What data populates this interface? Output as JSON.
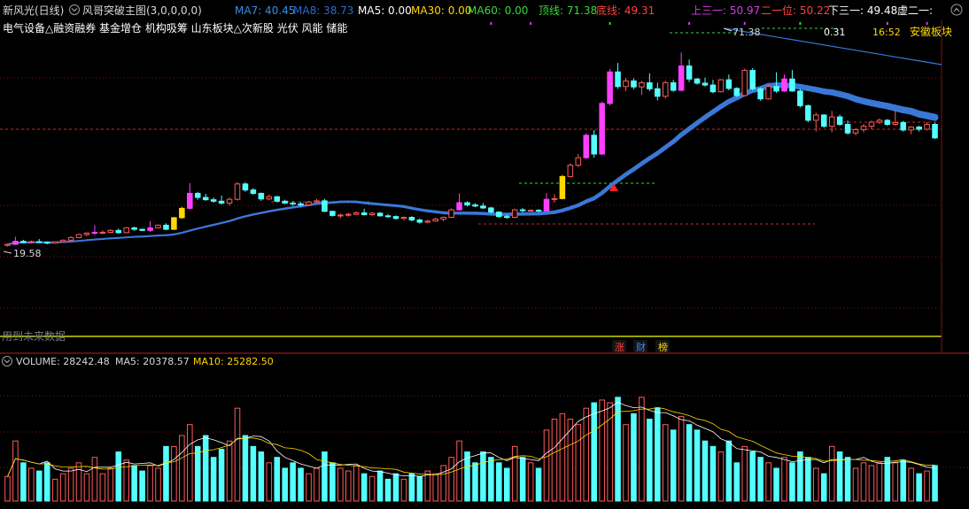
{
  "header": {
    "stock_name": "新风光(日线)",
    "indicator": "风哥突破主图(3,0,0,0,0)",
    "ma7": "MA7: 40.45",
    "ma8": "MA8: 38.73",
    "ma5": "MA5: 0.00",
    "ma30": "MA30: 0.00",
    "ma60": "MA60: 0.00",
    "top_line": "顶线: 71.38",
    "bottom_line": "底线: 49.31",
    "upper3": "上三一: 50.97",
    "second": "二一位: 50.22",
    "lower3": "下三一: 49.48",
    "virtual": "虚二一:"
  },
  "concepts": "电气设备△融资融券 基金增仓 机构吸筹 山东板块△次新股 光伏 风能 储能",
  "annotations": {
    "price_low": "19.58",
    "price_high": "71.38",
    "ratio": "0.31",
    "time": "16:52",
    "sector": "安徽板块",
    "future_data": "用到未来数据"
  },
  "bottom_buttons": [
    "涨",
    "财",
    "榜"
  ],
  "volume_header": {
    "label": "VOLUME: 28242.48",
    "ma5": "MA5: 20378.57",
    "ma10": "MA10: 25282.50"
  },
  "colors": {
    "up": "#ff5a5a",
    "down": "#54ffff",
    "signal_up": "#ff40ff",
    "signal_gold": "#ffd800",
    "ma_line": "#3a78d8",
    "volume_ma5": "#ffffff",
    "volume_ma10": "#ffd800",
    "grid": "#7a1414"
  },
  "chart_data": {
    "type": "candlestick",
    "ylim": [
      15,
      75
    ],
    "volume_ylim": [
      0,
      48000
    ],
    "candles": [
      {
        "o": 19.9,
        "h": 20.4,
        "l": 19.6,
        "c": 20.2,
        "v": 9000
      },
      {
        "o": 20.2,
        "h": 22.2,
        "l": 20.0,
        "c": 21.0,
        "v": 22000,
        "s": "p"
      },
      {
        "o": 21.0,
        "h": 21.4,
        "l": 20.5,
        "c": 20.7,
        "v": 14000
      },
      {
        "o": 20.7,
        "h": 21.2,
        "l": 20.4,
        "c": 20.9,
        "v": 12000
      },
      {
        "o": 20.9,
        "h": 21.6,
        "l": 20.6,
        "c": 20.8,
        "v": 11000
      },
      {
        "o": 20.8,
        "h": 21.0,
        "l": 20.2,
        "c": 20.5,
        "v": 14000
      },
      {
        "o": 20.5,
        "h": 21.0,
        "l": 20.3,
        "c": 20.9,
        "v": 8000
      },
      {
        "o": 20.9,
        "h": 21.5,
        "l": 20.7,
        "c": 21.3,
        "v": 10000
      },
      {
        "o": 21.3,
        "h": 22.3,
        "l": 21.1,
        "c": 22.0,
        "v": 12000
      },
      {
        "o": 22.0,
        "h": 23.0,
        "l": 21.8,
        "c": 22.8,
        "v": 14000
      },
      {
        "o": 22.8,
        "h": 23.4,
        "l": 22.4,
        "c": 23.2,
        "v": 10000
      },
      {
        "o": 23.2,
        "h": 25.3,
        "l": 22.8,
        "c": 23.4,
        "v": 16000,
        "s": "p"
      },
      {
        "o": 23.4,
        "h": 23.9,
        "l": 22.9,
        "c": 23.4,
        "v": 10000
      },
      {
        "o": 23.4,
        "h": 24.2,
        "l": 23.2,
        "c": 23.9,
        "v": 12000
      },
      {
        "o": 23.9,
        "h": 24.4,
        "l": 23.0,
        "c": 23.3,
        "v": 18000
      },
      {
        "o": 23.3,
        "h": 24.8,
        "l": 23.1,
        "c": 24.6,
        "v": 15000
      },
      {
        "o": 24.6,
        "h": 24.9,
        "l": 23.8,
        "c": 24.2,
        "v": 13000
      },
      {
        "o": 24.2,
        "h": 24.4,
        "l": 23.7,
        "c": 23.9,
        "v": 11000
      },
      {
        "o": 23.9,
        "h": 26.4,
        "l": 23.5,
        "c": 24.6,
        "v": 13000,
        "s": "p"
      },
      {
        "o": 24.6,
        "h": 25.5,
        "l": 24.4,
        "c": 25.3,
        "v": 12000
      },
      {
        "o": 25.3,
        "h": 25.8,
        "l": 24.0,
        "c": 24.2,
        "v": 20000
      },
      {
        "o": 24.2,
        "h": 27.5,
        "l": 24.0,
        "c": 27.3,
        "v": 20000,
        "s": "g"
      },
      {
        "o": 27.3,
        "h": 30.2,
        "l": 27.0,
        "c": 29.8,
        "v": 24000,
        "s": "g"
      },
      {
        "o": 29.8,
        "h": 36.5,
        "l": 29.5,
        "c": 33.8,
        "v": 28000,
        "s": "p"
      },
      {
        "o": 33.8,
        "h": 34.2,
        "l": 32.1,
        "c": 32.7,
        "v": 20000
      },
      {
        "o": 32.7,
        "h": 33.7,
        "l": 31.8,
        "c": 32.1,
        "v": 24000
      },
      {
        "o": 32.1,
        "h": 32.7,
        "l": 31.3,
        "c": 31.7,
        "v": 16000
      },
      {
        "o": 31.7,
        "h": 33.2,
        "l": 30.8,
        "c": 31.2,
        "v": 19000
      },
      {
        "o": 31.2,
        "h": 32.7,
        "l": 30.5,
        "c": 32.2,
        "v": 22000
      },
      {
        "o": 32.2,
        "h": 36.8,
        "l": 31.9,
        "c": 36.3,
        "v": 34000
      },
      {
        "o": 36.3,
        "h": 36.8,
        "l": 34.2,
        "c": 34.7,
        "v": 24000
      },
      {
        "o": 34.7,
        "h": 35.2,
        "l": 33.4,
        "c": 33.8,
        "v": 20000
      },
      {
        "o": 33.8,
        "h": 34.0,
        "l": 31.8,
        "c": 32.3,
        "v": 18000
      },
      {
        "o": 32.3,
        "h": 33.5,
        "l": 31.9,
        "c": 32.9,
        "v": 14000
      },
      {
        "o": 32.9,
        "h": 33.1,
        "l": 31.4,
        "c": 31.7,
        "v": 16000
      },
      {
        "o": 31.7,
        "h": 32.1,
        "l": 30.9,
        "c": 31.2,
        "v": 12000
      },
      {
        "o": 31.2,
        "h": 31.7,
        "l": 30.5,
        "c": 31.0,
        "v": 14000
      },
      {
        "o": 31.0,
        "h": 31.5,
        "l": 30.3,
        "c": 30.7,
        "v": 12000
      },
      {
        "o": 30.7,
        "h": 31.8,
        "l": 30.5,
        "c": 31.5,
        "v": 10000
      },
      {
        "o": 31.5,
        "h": 32.3,
        "l": 31.1,
        "c": 31.8,
        "v": 12000
      },
      {
        "o": 31.8,
        "h": 32.3,
        "l": 28.8,
        "c": 29.0,
        "v": 18000
      },
      {
        "o": 29.0,
        "h": 29.1,
        "l": 27.6,
        "c": 27.9,
        "v": 14000
      },
      {
        "o": 27.9,
        "h": 28.4,
        "l": 27.2,
        "c": 28.0,
        "v": 12000
      },
      {
        "o": 28.0,
        "h": 28.6,
        "l": 27.6,
        "c": 28.2,
        "v": 11000
      },
      {
        "o": 28.2,
        "h": 29.0,
        "l": 28.0,
        "c": 28.6,
        "v": 13000
      },
      {
        "o": 28.6,
        "h": 29.7,
        "l": 27.9,
        "c": 28.1,
        "v": 10000
      },
      {
        "o": 28.1,
        "h": 28.8,
        "l": 27.8,
        "c": 28.5,
        "v": 9000
      },
      {
        "o": 28.5,
        "h": 28.8,
        "l": 27.6,
        "c": 27.8,
        "v": 11000
      },
      {
        "o": 27.8,
        "h": 28.2,
        "l": 27.3,
        "c": 27.6,
        "v": 8000
      },
      {
        "o": 27.6,
        "h": 27.9,
        "l": 26.8,
        "c": 27.1,
        "v": 10000
      },
      {
        "o": 27.1,
        "h": 27.6,
        "l": 26.6,
        "c": 27.4,
        "v": 8000
      },
      {
        "o": 27.4,
        "h": 27.7,
        "l": 26.3,
        "c": 26.7,
        "v": 10000
      },
      {
        "o": 26.7,
        "h": 27.1,
        "l": 25.7,
        "c": 26.1,
        "v": 9000
      },
      {
        "o": 26.1,
        "h": 26.7,
        "l": 25.8,
        "c": 26.4,
        "v": 11000
      },
      {
        "o": 26.4,
        "h": 27.3,
        "l": 26.2,
        "c": 26.9,
        "v": 10000
      },
      {
        "o": 26.9,
        "h": 27.6,
        "l": 26.3,
        "c": 27.4,
        "v": 13000
      },
      {
        "o": 27.4,
        "h": 29.8,
        "l": 27.2,
        "c": 29.4,
        "v": 16000
      },
      {
        "o": 29.4,
        "h": 33.8,
        "l": 29.2,
        "c": 31.3,
        "v": 22000,
        "s": "p"
      },
      {
        "o": 31.3,
        "h": 31.7,
        "l": 30.3,
        "c": 30.7,
        "v": 18000
      },
      {
        "o": 30.7,
        "h": 31.2,
        "l": 30.1,
        "c": 30.4,
        "v": 14000
      },
      {
        "o": 30.4,
        "h": 31.2,
        "l": 29.6,
        "c": 29.9,
        "v": 18000
      },
      {
        "o": 29.9,
        "h": 30.2,
        "l": 28.4,
        "c": 28.8,
        "v": 16000
      },
      {
        "o": 28.8,
        "h": 29.0,
        "l": 27.3,
        "c": 27.6,
        "v": 14000
      },
      {
        "o": 27.6,
        "h": 28.1,
        "l": 27.0,
        "c": 27.4,
        "v": 12000
      },
      {
        "o": 27.4,
        "h": 29.7,
        "l": 27.2,
        "c": 29.4,
        "v": 20000
      },
      {
        "o": 29.4,
        "h": 29.9,
        "l": 28.8,
        "c": 29.2,
        "v": 16000
      },
      {
        "o": 29.2,
        "h": 29.5,
        "l": 28.9,
        "c": 29.3,
        "v": 14000
      },
      {
        "o": 29.3,
        "h": 29.6,
        "l": 28.8,
        "c": 29.1,
        "v": 12000
      },
      {
        "o": 29.1,
        "h": 33.8,
        "l": 28.9,
        "c": 32.2,
        "v": 26000,
        "s": "p"
      },
      {
        "o": 32.2,
        "h": 33.6,
        "l": 31.3,
        "c": 32.4,
        "v": 30000
      },
      {
        "o": 32.4,
        "h": 38.7,
        "l": 32.2,
        "c": 38.3,
        "v": 32000,
        "s": "g"
      },
      {
        "o": 38.3,
        "h": 41.8,
        "l": 38.0,
        "c": 41.3,
        "v": 30000
      },
      {
        "o": 41.3,
        "h": 44.3,
        "l": 40.8,
        "c": 43.3,
        "v": 28000
      },
      {
        "o": 43.3,
        "h": 49.8,
        "l": 43.0,
        "c": 49.3,
        "v": 34000,
        "s": "p"
      },
      {
        "o": 49.3,
        "h": 50.7,
        "l": 43.3,
        "c": 44.3,
        "v": 36000
      },
      {
        "o": 44.3,
        "h": 58.3,
        "l": 44.0,
        "c": 57.8,
        "v": 37000,
        "s": "p"
      },
      {
        "o": 57.8,
        "h": 67.0,
        "l": 57.3,
        "c": 66.2,
        "v": 36000,
        "s": "p"
      },
      {
        "o": 66.2,
        "h": 68.6,
        "l": 61.7,
        "c": 62.3,
        "v": 38000
      },
      {
        "o": 62.3,
        "h": 64.6,
        "l": 61.1,
        "c": 63.8,
        "v": 28000
      },
      {
        "o": 63.8,
        "h": 64.5,
        "l": 61.6,
        "c": 62.2,
        "v": 32000
      },
      {
        "o": 62.2,
        "h": 63.8,
        "l": 60.1,
        "c": 63.3,
        "v": 38000
      },
      {
        "o": 63.3,
        "h": 65.8,
        "l": 61.1,
        "c": 61.7,
        "v": 30000
      },
      {
        "o": 61.7,
        "h": 63.3,
        "l": 58.6,
        "c": 59.7,
        "v": 34000
      },
      {
        "o": 59.7,
        "h": 63.8,
        "l": 59.1,
        "c": 63.3,
        "v": 28000
      },
      {
        "o": 63.3,
        "h": 64.1,
        "l": 60.9,
        "c": 61.3,
        "v": 26000
      },
      {
        "o": 61.3,
        "h": 71.4,
        "l": 61.0,
        "c": 67.8,
        "v": 31000,
        "s": "p"
      },
      {
        "o": 67.8,
        "h": 69.5,
        "l": 63.5,
        "c": 64.3,
        "v": 28000
      },
      {
        "o": 64.3,
        "h": 64.6,
        "l": 62.8,
        "c": 63.2,
        "v": 26000
      },
      {
        "o": 63.2,
        "h": 64.7,
        "l": 62.3,
        "c": 62.7,
        "v": 22000
      },
      {
        "o": 62.7,
        "h": 64.1,
        "l": 60.5,
        "c": 60.9,
        "v": 20000
      },
      {
        "o": 60.9,
        "h": 64.3,
        "l": 60.7,
        "c": 64.1,
        "v": 18000
      },
      {
        "o": 64.1,
        "h": 65.5,
        "l": 61.3,
        "c": 61.8,
        "v": 22000
      },
      {
        "o": 61.8,
        "h": 62.1,
        "l": 59.5,
        "c": 59.9,
        "v": 14000
      },
      {
        "o": 59.9,
        "h": 67.1,
        "l": 59.6,
        "c": 66.6,
        "v": 20000
      },
      {
        "o": 66.6,
        "h": 67.2,
        "l": 61.2,
        "c": 61.7,
        "v": 18000
      },
      {
        "o": 61.7,
        "h": 62.1,
        "l": 58.5,
        "c": 59.0,
        "v": 16000
      },
      {
        "o": 59.0,
        "h": 62.8,
        "l": 58.8,
        "c": 62.3,
        "v": 14000
      },
      {
        "o": 62.3,
        "h": 66.1,
        "l": 60.6,
        "c": 61.1,
        "v": 12000
      },
      {
        "o": 61.1,
        "h": 65.5,
        "l": 60.8,
        "c": 64.3,
        "v": 16000,
        "s": "p"
      },
      {
        "o": 64.3,
        "h": 66.7,
        "l": 60.9,
        "c": 61.1,
        "v": 14000
      },
      {
        "o": 61.1,
        "h": 61.7,
        "l": 56.7,
        "c": 57.2,
        "v": 18000
      },
      {
        "o": 57.2,
        "h": 57.5,
        "l": 52.8,
        "c": 53.3,
        "v": 16000
      },
      {
        "o": 53.3,
        "h": 55.3,
        "l": 50.3,
        "c": 54.7,
        "v": 12000
      },
      {
        "o": 54.7,
        "h": 54.9,
        "l": 51.3,
        "c": 51.7,
        "v": 10000
      },
      {
        "o": 51.7,
        "h": 55.8,
        "l": 50.1,
        "c": 54.2,
        "v": 20000
      },
      {
        "o": 54.2,
        "h": 54.8,
        "l": 51.8,
        "c": 52.2,
        "v": 18000
      },
      {
        "o": 52.2,
        "h": 53.3,
        "l": 49.5,
        "c": 49.9,
        "v": 16000
      },
      {
        "o": 49.9,
        "h": 51.2,
        "l": 49.3,
        "c": 50.8,
        "v": 12000
      },
      {
        "o": 50.8,
        "h": 52.3,
        "l": 50.1,
        "c": 51.7,
        "v": 14000
      },
      {
        "o": 51.7,
        "h": 53.2,
        "l": 50.9,
        "c": 52.8,
        "v": 13000
      },
      {
        "o": 52.8,
        "h": 53.8,
        "l": 52.3,
        "c": 53.3,
        "v": 14000
      },
      {
        "o": 53.3,
        "h": 53.6,
        "l": 51.8,
        "c": 52.2,
        "v": 16000
      },
      {
        "o": 52.2,
        "h": 55.9,
        "l": 51.9,
        "c": 52.7,
        "v": 14000
      },
      {
        "o": 52.7,
        "h": 53.1,
        "l": 50.3,
        "c": 50.7,
        "v": 15000
      },
      {
        "o": 50.7,
        "h": 51.7,
        "l": 49.6,
        "c": 51.5,
        "v": 12000
      },
      {
        "o": 51.5,
        "h": 51.8,
        "l": 50.3,
        "c": 50.9,
        "v": 10000
      },
      {
        "o": 50.9,
        "h": 52.8,
        "l": 50.6,
        "c": 52.2,
        "v": 11000
      },
      {
        "o": 52.2,
        "h": 52.6,
        "l": 48.3,
        "c": 48.6,
        "v": 13000
      }
    ]
  }
}
